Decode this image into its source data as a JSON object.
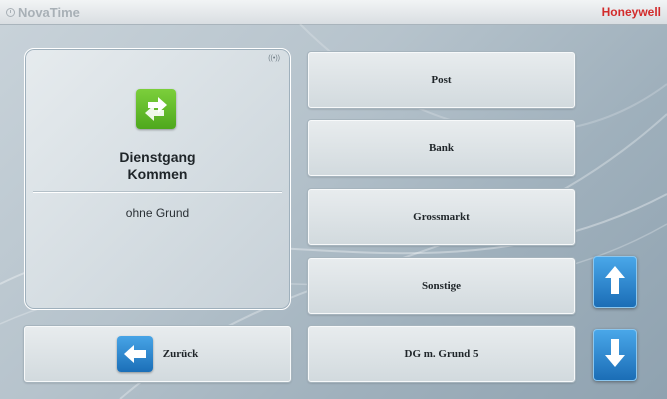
{
  "header": {
    "app_name": "NovaTime",
    "brand": "Honeywell"
  },
  "status": {
    "connection_indicator": "((•))"
  },
  "selected_action": {
    "icon": "transfer-arrows-icon",
    "title_line1": "Dienstgang",
    "title_line2": "Kommen",
    "reason": "ohne Grund"
  },
  "reasons": {
    "items": [
      {
        "label": "Post"
      },
      {
        "label": "Bank"
      },
      {
        "label": "Grossmarkt"
      },
      {
        "label": "Sonstige"
      },
      {
        "label": "DG m. Grund 5"
      }
    ]
  },
  "navigation": {
    "back_label": "Zurück"
  },
  "colors": {
    "brand_red": "#d22b2b",
    "action_green": "#5cb82a",
    "nav_blue": "#1f77c4"
  }
}
